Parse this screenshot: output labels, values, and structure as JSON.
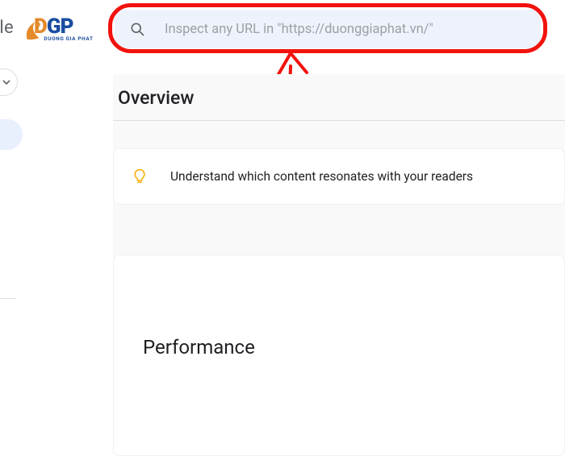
{
  "app_title_fragment": "onsole",
  "logo": {
    "letters": [
      "D",
      "G",
      "P"
    ],
    "tag": "DUONG GIA PHAT"
  },
  "search": {
    "placeholder": "Inspect any URL in \"https://duonggiaphat.vn/\""
  },
  "overview": {
    "title": "Overview"
  },
  "insight_card": {
    "text": "Understand which content resonates with your readers"
  },
  "performance": {
    "title": "Performance"
  },
  "annotation": {
    "color": "#f2120d"
  }
}
